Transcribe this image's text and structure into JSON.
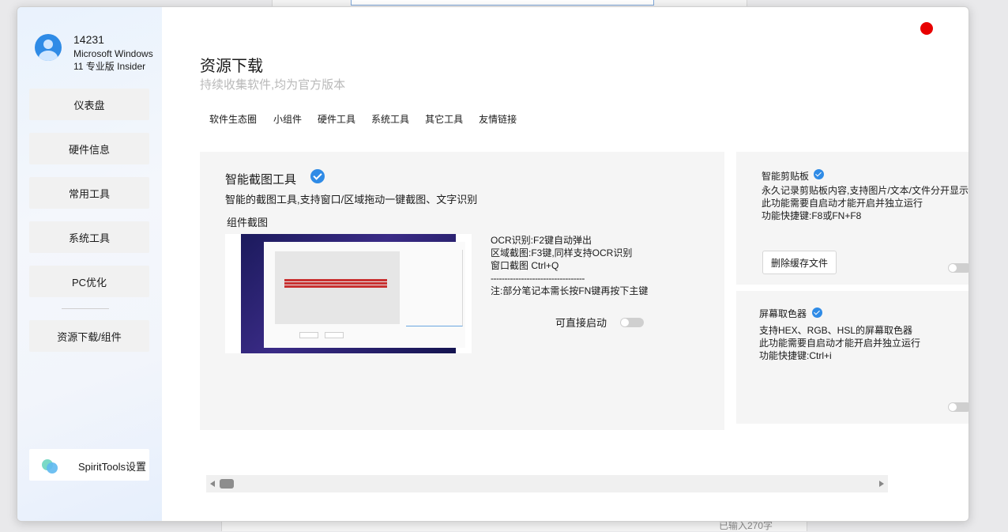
{
  "user": {
    "name": "14231",
    "os": "Microsoft Windows 11 专业版 Insider"
  },
  "sidebar": {
    "items": [
      {
        "label": "仪表盘"
      },
      {
        "label": "硬件信息"
      },
      {
        "label": "常用工具"
      },
      {
        "label": "系统工具"
      },
      {
        "label": "PC优化"
      },
      {
        "label": "资源下载/组件"
      }
    ],
    "settings_label": "SpiritTools设置"
  },
  "page": {
    "title": "资源下载",
    "subtitle": "持续收集软件,均为官方版本"
  },
  "tabs": [
    {
      "label": "软件生态圈"
    },
    {
      "label": "小组件"
    },
    {
      "label": "硬件工具"
    },
    {
      "label": "系统工具"
    },
    {
      "label": "其它工具"
    },
    {
      "label": "友情链接"
    }
  ],
  "main_card": {
    "title": "智能截图工具",
    "description": "智能的截图工具,支持窗口/区域拖动一键截图、文字识别",
    "subheading": "组件截图",
    "info_lines": [
      "OCR识别:F2键自动弹出",
      "区域截图:F3键,同样支持OCR识别",
      "窗口截图 Ctrl+Q",
      "----------------------------------",
      "注:部分笔记本需长按FN键再按下主键"
    ],
    "start_label": "可直接启动",
    "toggle_on": false
  },
  "clipboard_card": {
    "title": "智能剪贴板",
    "lines": [
      "永久记录剪贴板内容,支持图片/文本/文件分开显示",
      "此功能需要自启动才能开启并独立运行",
      "功能快捷键:F8或FN+F8"
    ],
    "button_label": "删除缓存文件",
    "toggle_on": false
  },
  "picker_card": {
    "title": "屏幕取色器",
    "lines": [
      "支持HEX、RGB、HSL的屏幕取色器",
      "此功能需要自启动才能开启并独立运行",
      "功能快捷键:Ctrl+i"
    ],
    "toggle_on": false
  },
  "background": {
    "status_text": "已输入270字"
  },
  "colors": {
    "accent": "#2f8be6",
    "close": "#e80000",
    "card_bg": "#f5f5f5"
  },
  "icons": {
    "avatar": "user-avatar-icon",
    "check": "verified-check-icon",
    "close": "close-dot-icon",
    "settings": "spirit-logo-icon"
  }
}
